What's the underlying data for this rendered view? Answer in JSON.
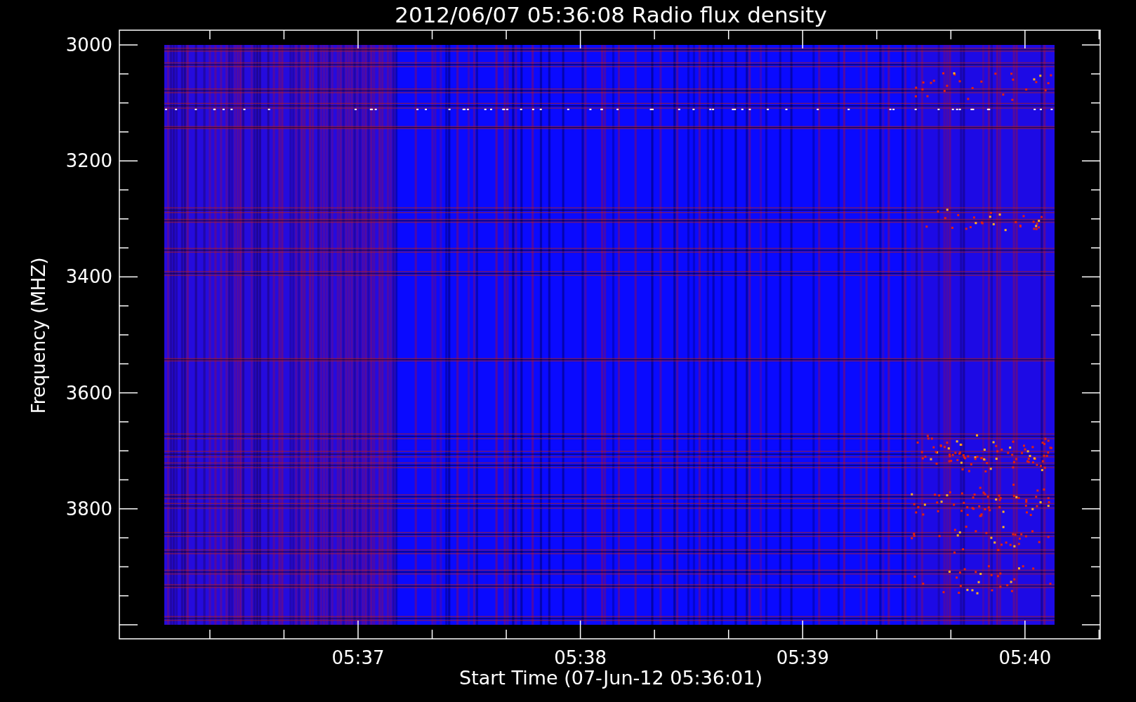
{
  "title": "2012/06/07 05:36:08 Radio flux density",
  "plot": {
    "ylabel": "Frequency (MHZ)",
    "xlabel": "Start Time (07-Jun-12 05:36:01)",
    "yticks": [
      "3000",
      "3200",
      "3400",
      "3600",
      "3800"
    ],
    "xticks": [
      "05:37",
      "05:38",
      "05:39",
      "05:40"
    ]
  }
}
